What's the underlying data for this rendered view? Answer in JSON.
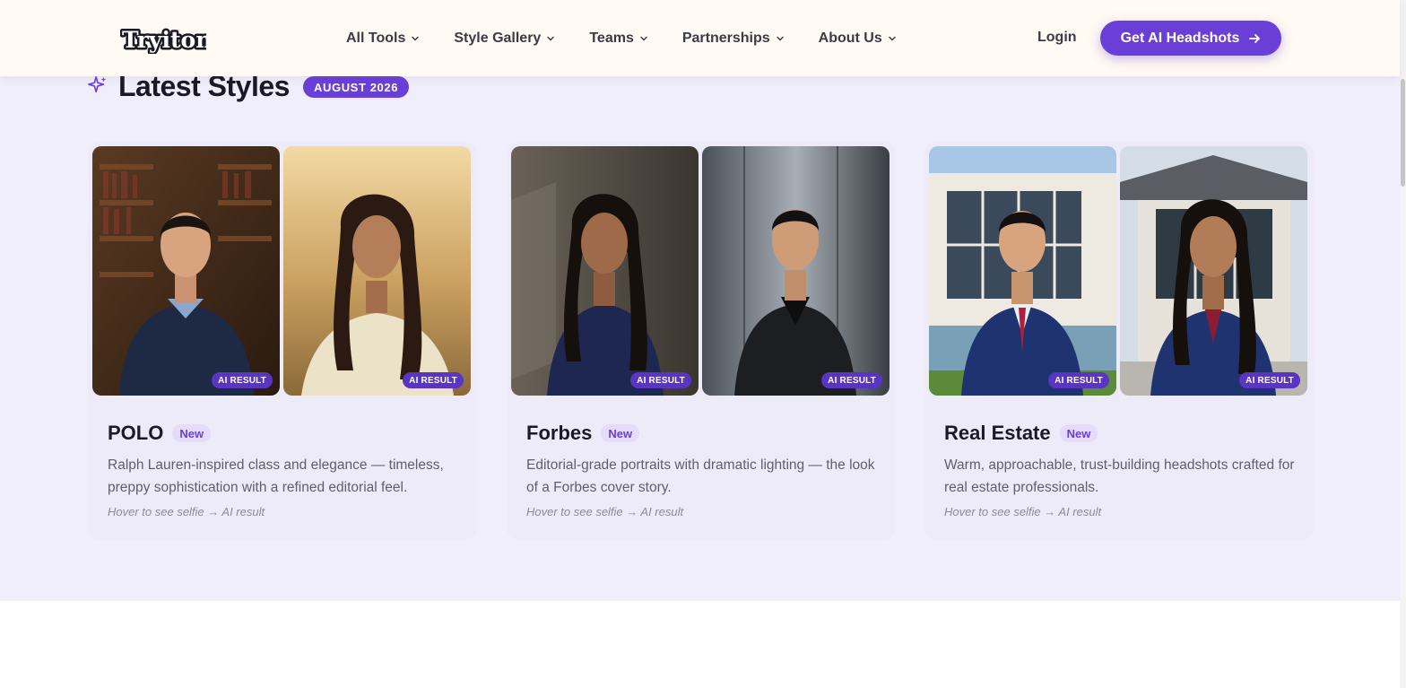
{
  "header": {
    "logo_text": "Tryiton",
    "nav": [
      {
        "label": "All Tools"
      },
      {
        "label": "Style Gallery"
      },
      {
        "label": "Teams"
      },
      {
        "label": "Partnerships"
      },
      {
        "label": "About Us"
      }
    ],
    "login_label": "Login",
    "cta_label": "Get AI Headshots"
  },
  "section": {
    "title": "Latest Styles",
    "badge": "AUGUST 2026"
  },
  "cards": [
    {
      "name": "POLO",
      "badge": "New",
      "description": "Ralph Lauren-inspired class and elegance — timeless, preppy sophistication with a refined editorial feel.",
      "hint": "Hover to see selfie → AI result",
      "photos": [
        {
          "badge": "AI RESULT"
        },
        {
          "badge": "AI RESULT"
        }
      ]
    },
    {
      "name": "Forbes",
      "badge": "New",
      "description": "Editorial-grade portraits with dramatic lighting — the look of a Forbes cover story.",
      "hint": "Hover to see selfie → AI result",
      "photos": [
        {
          "badge": "AI RESULT"
        },
        {
          "badge": "AI RESULT"
        }
      ]
    },
    {
      "name": "Real Estate",
      "badge": "New",
      "description": "Warm, approachable, trust-building headshots crafted for real estate professionals.",
      "hint": "Hover to see selfie → AI result",
      "photos": [
        {
          "badge": "AI RESULT"
        },
        {
          "badge": "AI RESULT"
        }
      ]
    }
  ],
  "colors": {
    "accent": "#6a3fd7",
    "section_bg": "#f0eefa",
    "header_bg": "#fffaf3",
    "card_bg": "#eeebf8"
  },
  "icons": {
    "sparkle": "sparkle-icon",
    "chevron": "chevron-down-icon",
    "arrow": "arrow-right-icon"
  }
}
